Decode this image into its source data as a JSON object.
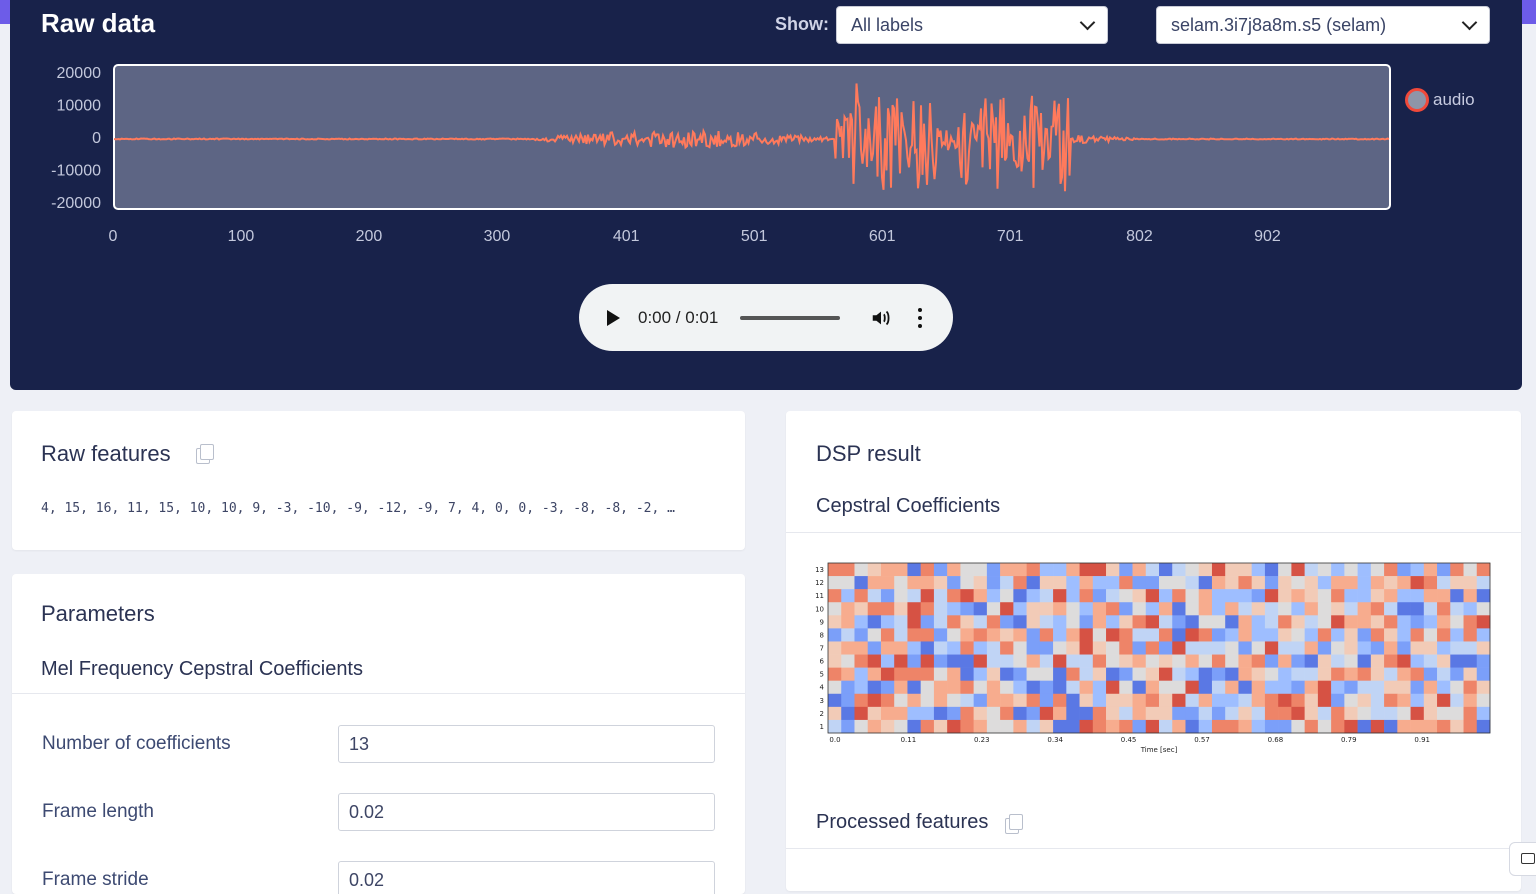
{
  "raw_data": {
    "title": "Raw data",
    "show_label": "Show:",
    "label_filter": "All labels",
    "sample": "selam.3i7j8a8m.s5 (selam)",
    "legend": "audio",
    "audio_time": "0:00 / 0:01",
    "colors": {
      "background": "#18224a",
      "wave": "#ff7a5c",
      "plot_area": "#5d6584"
    }
  },
  "chart_data": [
    {
      "type": "line",
      "series": [
        {
          "name": "audio",
          "description_values": "waveform"
        }
      ],
      "y_ticks": [
        "20000",
        "10000",
        "0",
        "-10000",
        "-20000"
      ],
      "x_ticks": [
        "0",
        "100",
        "200",
        "300",
        "401",
        "501",
        "601",
        "701",
        "802",
        "902"
      ],
      "ylim": [
        -20000,
        20000
      ],
      "xlim": [
        0,
        997
      ]
    },
    {
      "type": "heatmap",
      "xlabel": "Time [sec]",
      "x_ticks": [
        "0.0",
        "0.11",
        "0.23",
        "0.34",
        "0.45",
        "0.57",
        "0.68",
        "0.79",
        "0.91"
      ],
      "y_ticks": [
        "1",
        "2",
        "3",
        "4",
        "5",
        "6",
        "7",
        "8",
        "9",
        "10",
        "11",
        "12",
        "13"
      ],
      "colormap": "coolwarm"
    }
  ],
  "raw_features": {
    "title": "Raw features",
    "values": "4, 15, 16, 11, 15, 10, 10, 9, -3, -10, -9, -12, -9, 7, 4, 0, 0, -3, -8, -8, -2, …"
  },
  "parameters": {
    "title": "Parameters",
    "subtitle": "Mel Frequency Cepstral Coefficients",
    "fields": [
      {
        "label": "Number of coefficients",
        "value": "13"
      },
      {
        "label": "Frame length",
        "value": "0.02"
      },
      {
        "label": "Frame stride",
        "value": "0.02"
      }
    ]
  },
  "dsp_result": {
    "title": "DSP result",
    "cepstral_title": "Cepstral Coefficients",
    "processed_title": "Processed features"
  }
}
